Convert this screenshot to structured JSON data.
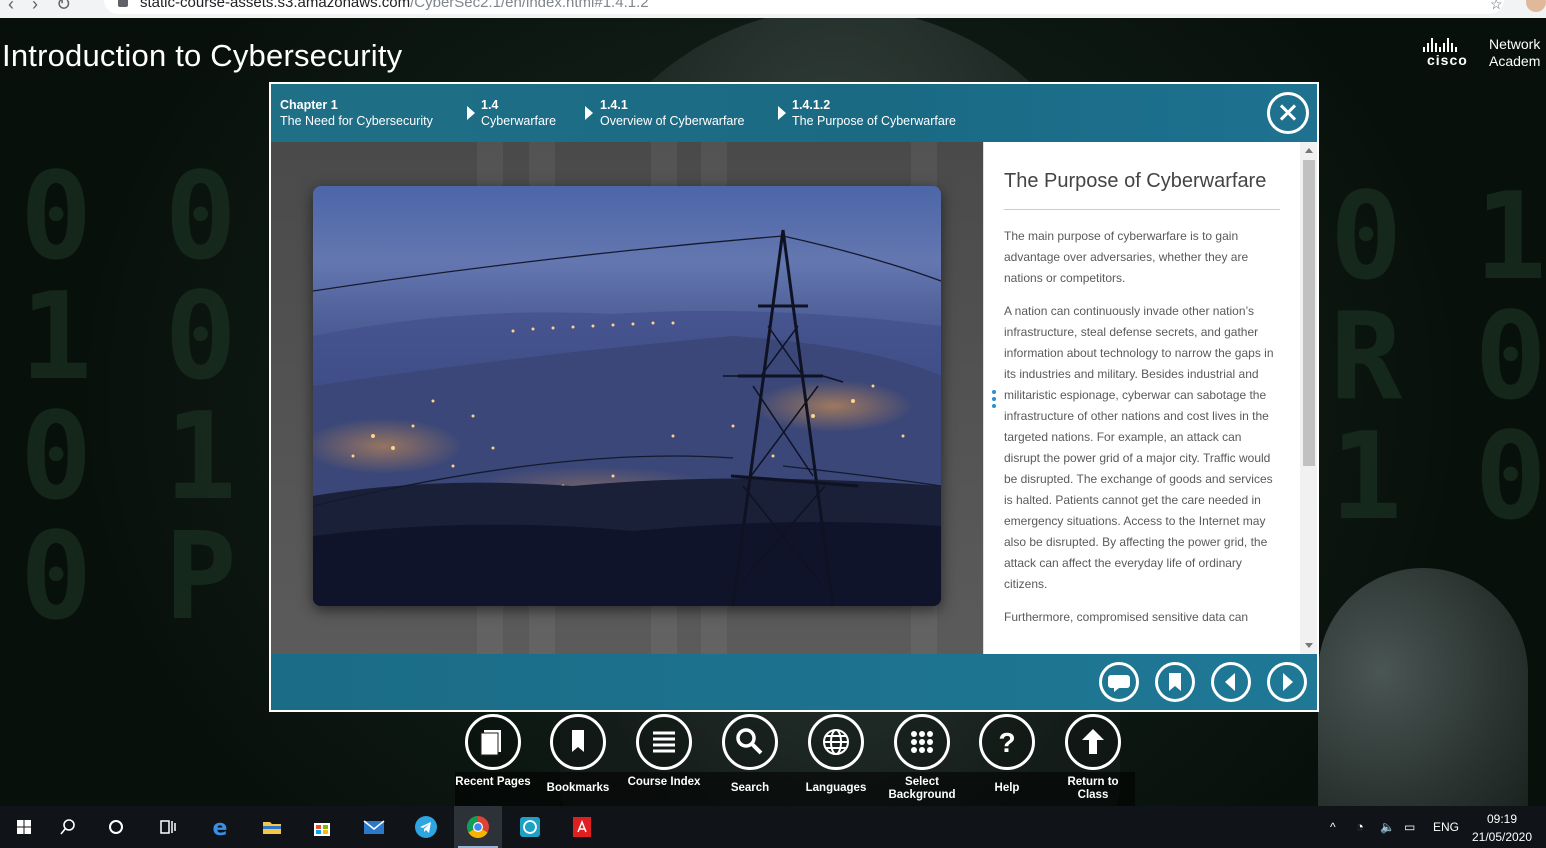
{
  "browser": {
    "url_host": "static-course-assets.s3.amazonaws.com",
    "url_path": "/CyberSec2.1/en/index.html#1.4.1.2"
  },
  "course": {
    "title": "Introduction to Cybersecurity",
    "logo_word": "cisco",
    "logo_tag_line1": "Network",
    "logo_tag_line2": "Academ"
  },
  "breadcrumb": [
    {
      "num": "Chapter 1",
      "label": "The Need for Cybersecurity"
    },
    {
      "num": "1.4",
      "label": "Cyberwarfare"
    },
    {
      "num": "1.4.1",
      "label": "Overview of Cyberwarfare"
    },
    {
      "num": "1.4.1.2",
      "label": "The Purpose of Cyberwarfare"
    }
  ],
  "article": {
    "heading": "The Purpose of Cyberwarfare",
    "paragraphs": [
      "The main purpose of cyberwarfare is to gain advantage over adversaries, whether they are nations or competitors.",
      "A nation can continuously invade other nation’s infrastructure, steal defense secrets, and gather information about technology to narrow the gaps in its industries and military. Besides industrial and militaristic espionage, cyberwar can sabotage the infrastructure of other nations and cost lives in the targeted nations. For example, an attack can disrupt the power grid of a major city. Traffic would be disrupted. The exchange of goods and services is halted. Patients cannot get the care needed in emergency situations. Access to the Internet may also be disrupted. By affecting the power grid, the attack can affect the everyday life of ordinary citizens.",
      "Furthermore, compromised sensitive data can"
    ]
  },
  "image": {
    "icon": "power-pylon-city-photo"
  },
  "footer_buttons": [
    {
      "icon": "comment-icon"
    },
    {
      "icon": "bookmark-icon"
    },
    {
      "icon": "previous-arrow-icon"
    },
    {
      "icon": "next-arrow-icon"
    }
  ],
  "toolbar": [
    {
      "label": "Recent Pages",
      "icon": "pages-icon"
    },
    {
      "label": "Bookmarks",
      "icon": "bookmark-icon"
    },
    {
      "label": "Course Index",
      "icon": "list-icon"
    },
    {
      "label": "Search",
      "icon": "search-icon"
    },
    {
      "label": "Languages",
      "icon": "globe-icon"
    },
    {
      "label": "Select Background",
      "icon": "grid-dots-icon"
    },
    {
      "label": "Help",
      "icon": "help-icon"
    },
    {
      "label": "Return to Class",
      "icon": "up-arrow-icon"
    }
  ],
  "taskbar": {
    "language": "ENG",
    "time": "09:19",
    "date": "21/05/2020"
  },
  "colors": {
    "header": "#1f6f87",
    "footer": "#1e7896",
    "accent_dots": "#2b8fd0"
  }
}
